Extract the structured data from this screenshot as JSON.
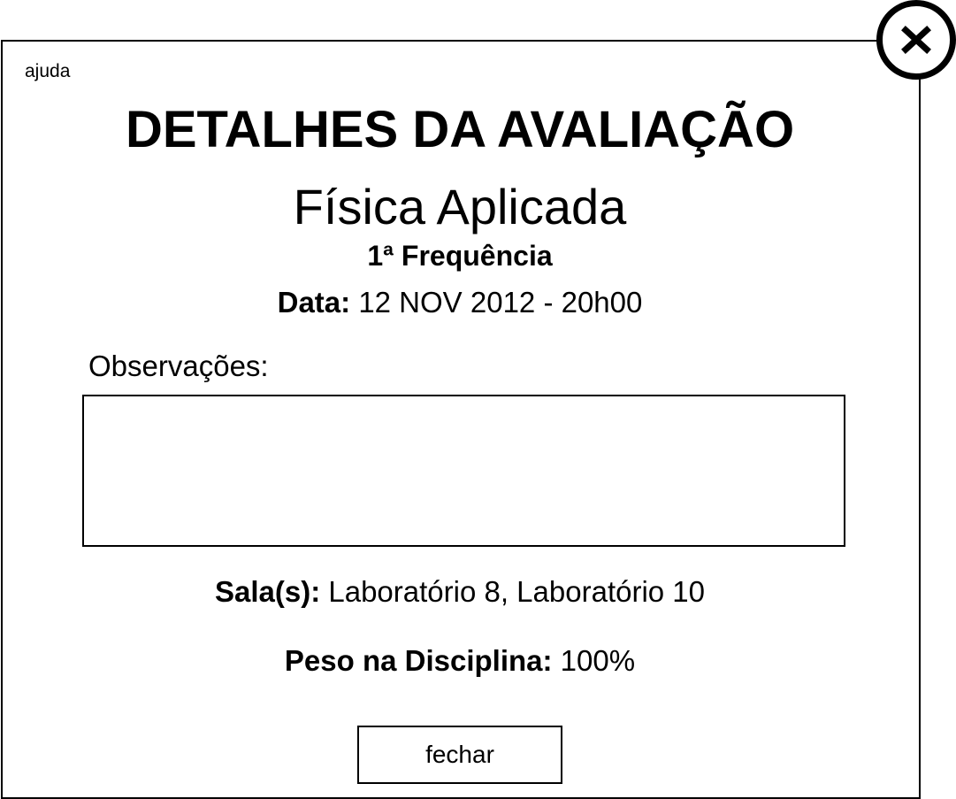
{
  "dialog": {
    "help_link": "ajuda",
    "close_icon": "close-x-icon",
    "title": "DETALHES DA AVALIAÇÃO",
    "subject": "Física Aplicada",
    "evaluation_type": "1ª Frequência",
    "date": {
      "label": "Data:",
      "value": "12 NOV 2012 - 20h00"
    },
    "observations": {
      "label": "Observações:",
      "value": ""
    },
    "rooms": {
      "label": "Sala(s):",
      "value": "Laboratório 8, Laboratório 10"
    },
    "weight": {
      "label": "Peso na Disciplina:",
      "value": "100%"
    },
    "close_button_label": "fechar"
  },
  "colors": {
    "foreground": "#000000",
    "background": "#ffffff"
  }
}
